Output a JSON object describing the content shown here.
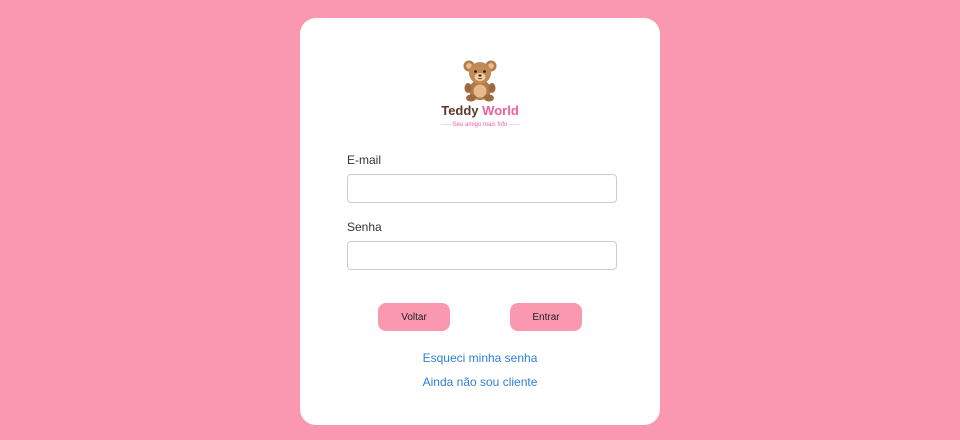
{
  "brand": {
    "name_part1": "Teddy",
    "name_part2": "World",
    "tagline": "Seu amigo mais fofo"
  },
  "form": {
    "email_label": "E-mail",
    "email_value": "",
    "password_label": "Senha",
    "password_value": ""
  },
  "actions": {
    "back_label": "Voltar",
    "login_label": "Entrar"
  },
  "links": {
    "forgot_password": "Esqueci minha senha",
    "not_client": "Ainda não sou cliente"
  },
  "colors": {
    "background": "#fa98b0",
    "button": "#fa98b0",
    "link": "#2f7fd8",
    "brand_dark": "#5b3a29",
    "brand_pink": "#ee5ea0"
  },
  "icons": {
    "logo": "teddy-bear-icon"
  }
}
